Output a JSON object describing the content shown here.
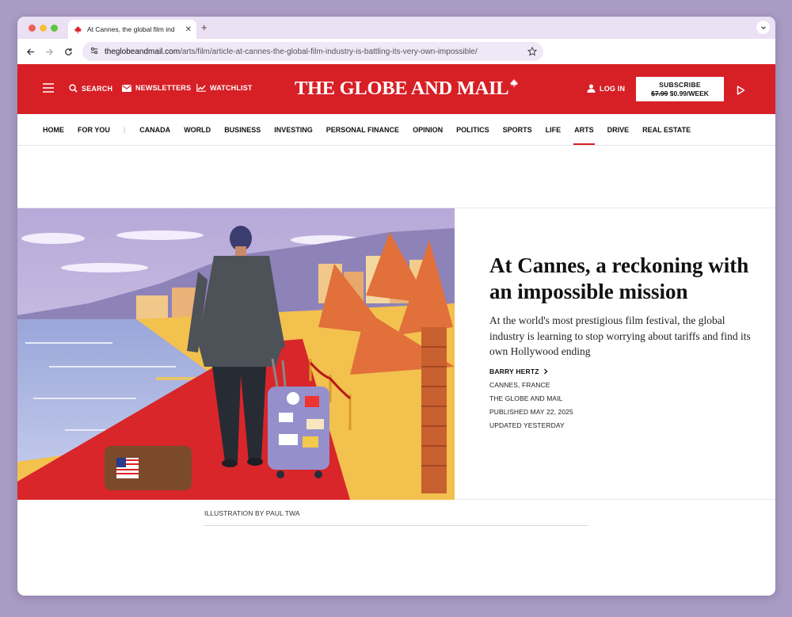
{
  "browser": {
    "tab_title": "At Cannes, the global film ind",
    "url_host": "theglobeandmail.com",
    "url_path": "/arts/film/article-at-cannes-the-global-film-industry-is-battling-its-very-own-impossible/"
  },
  "header": {
    "search_label": "SEARCH",
    "newsletters_label": "NEWSLETTERS",
    "watchlist_label": "WATCHLIST",
    "logo_text": "THE GLOBE AND MAIL",
    "login_label": "LOG IN",
    "subscribe_title": "SUBSCRIBE",
    "subscribe_old_price": "$7.99",
    "subscribe_new_price": "$0.99/WEEK",
    "brand_color": "#d71f26"
  },
  "nav": {
    "items": [
      "HOME",
      "FOR YOU",
      "CANADA",
      "WORLD",
      "BUSINESS",
      "INVESTING",
      "PERSONAL FINANCE",
      "OPINION",
      "POLITICS",
      "SPORTS",
      "LIFE",
      "ARTS",
      "DRIVE",
      "REAL ESTATE"
    ],
    "separator": "|",
    "active": "ARTS"
  },
  "article": {
    "headline": "At Cannes, a reckoning with an impossible mission",
    "dek": "At the world's most prestigious film festival, the global industry is learning to stop worrying about tariffs and find its own Hollywood ending",
    "author": "BARRY HERTZ",
    "location": "CANNES, FRANCE",
    "publication": "THE GLOBE AND MAIL",
    "published": "PUBLISHED MAY 22, 2025",
    "updated": "UPDATED YESTERDAY",
    "caption": "ILLUSTRATION BY PAUL TWA"
  }
}
